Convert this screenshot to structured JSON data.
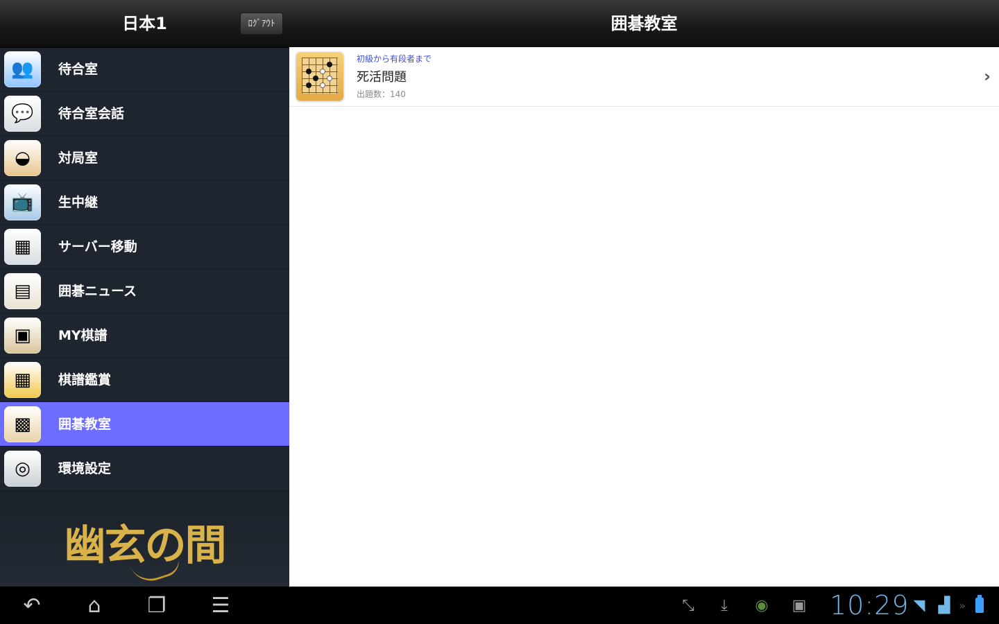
{
  "left_header": {
    "title": "日本1",
    "logout_label": "ﾛｸﾞｱｳﾄ"
  },
  "menu": [
    {
      "label": "待合室",
      "icon": "people-icon",
      "color": "#8fc3ff"
    },
    {
      "label": "待合室会話",
      "icon": "chat-bubbles-icon",
      "color": "#d9dde2"
    },
    {
      "label": "対局室",
      "icon": "go-bowl-icon",
      "color": "#e8c48c"
    },
    {
      "label": "生中継",
      "icon": "tv-icon",
      "color": "#a8c8e8"
    },
    {
      "label": "サーバー移動",
      "icon": "server-map-icon",
      "color": "#d8dde3"
    },
    {
      "label": "囲碁ニュース",
      "icon": "newspaper-icon",
      "color": "#e9e3d4"
    },
    {
      "label": "MY棋譜",
      "icon": "kifu-box-icon",
      "color": "#d8c49a"
    },
    {
      "label": "棋譜鑑賞",
      "icon": "go-board-icon",
      "color": "#f1c84a"
    },
    {
      "label": "囲碁教室",
      "icon": "classroom-board-icon",
      "color": "#e8d3a6",
      "selected": true
    },
    {
      "label": "環境設定",
      "icon": "settings-disc-icon",
      "color": "#c9ced5"
    }
  ],
  "logo": {
    "text": "幽玄の間"
  },
  "right_header": {
    "title": "囲碁教室"
  },
  "lessons": [
    {
      "subtitle": "初級から有段者まで",
      "title": "死活問題",
      "count": "出題数：140"
    }
  ],
  "system_bar": {
    "nav": [
      {
        "name": "back",
        "glyph": "↶"
      },
      {
        "name": "home",
        "glyph": "⌂"
      },
      {
        "name": "recent-apps",
        "glyph": "❐"
      },
      {
        "name": "menu",
        "glyph": "☰"
      }
    ],
    "status_icons": [
      {
        "name": "screen-compat-icon",
        "glyph": "⤡"
      },
      {
        "name": "download-icon",
        "glyph": "⤓"
      },
      {
        "name": "nvidia-icon",
        "glyph": "◉"
      },
      {
        "name": "image-icon",
        "glyph": "▣"
      }
    ],
    "time": "10:29",
    "colors": {
      "clock": "#6fb8e8",
      "battery": "#3aa0ff",
      "selection": "#6d6dff"
    }
  }
}
